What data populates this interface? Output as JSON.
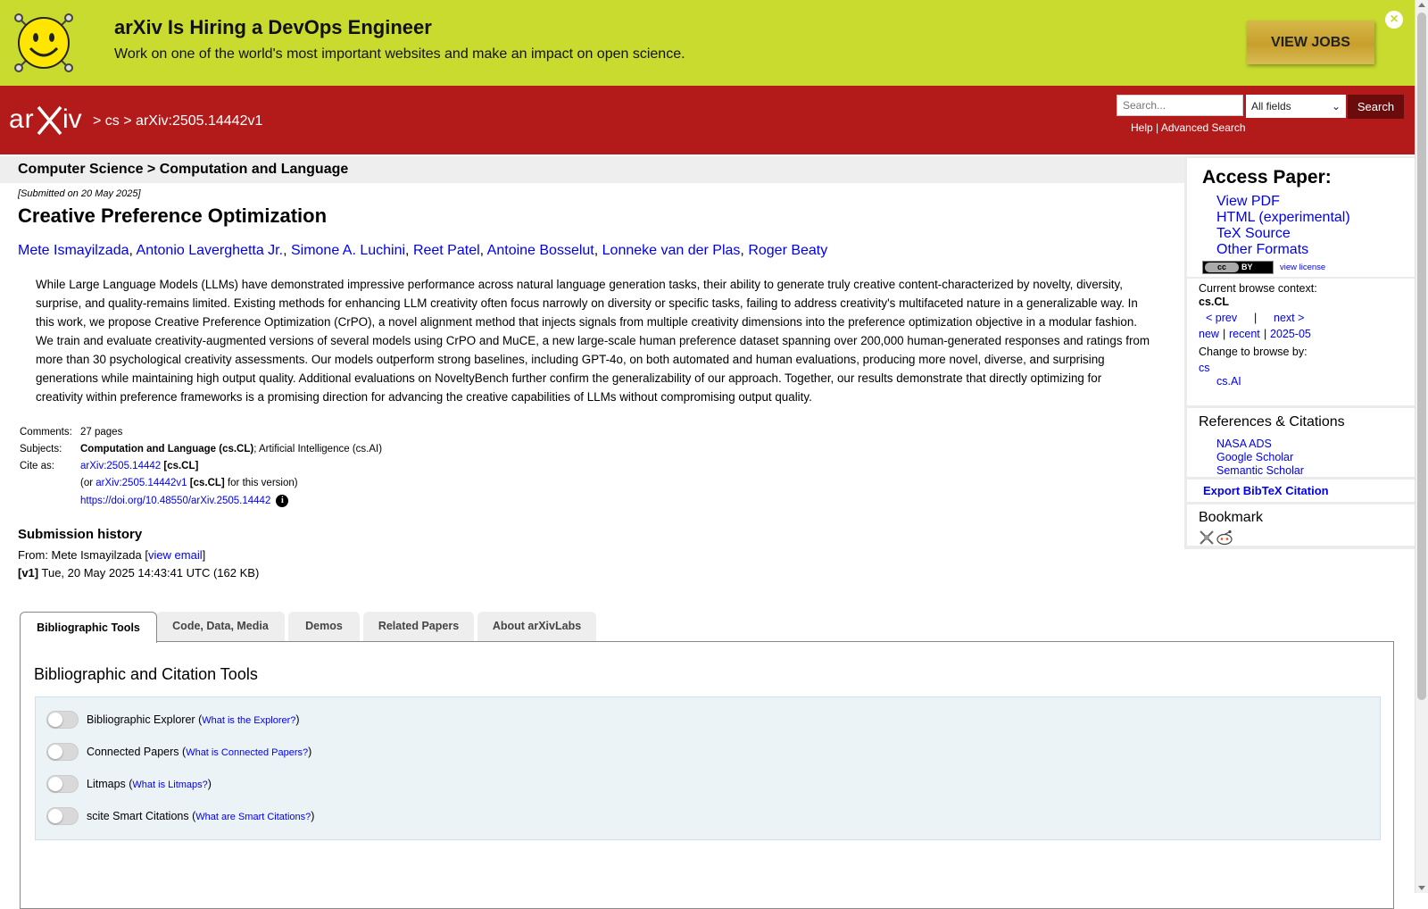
{
  "banner": {
    "title": "arXiv Is Hiring a DevOps Engineer",
    "subtitle": "Work on one of the world's most important websites and make an impact on open science.",
    "button": "VIEW JOBS",
    "close_icon": "close-circle-icon"
  },
  "header": {
    "logo_text": "arXiv",
    "breadcrumb": {
      "sep1": ">",
      "cs": "cs",
      "sep2": ">",
      "paper": "arXiv:2505.14442v1"
    },
    "search": {
      "placeholder": "Search...",
      "field": "All fields",
      "button": "Search",
      "help": "Help",
      "pipe": "|",
      "advanced": "Advanced Search"
    }
  },
  "paper": {
    "subject_bar": "Computer Science > Computation and Language",
    "submitted": "[Submitted on 20 May 2025]",
    "title": "Creative Preference Optimization",
    "authors": [
      "Mete Ismayilzada",
      "Antonio Laverghetta Jr.",
      "Simone A. Luchini",
      "Reet Patel",
      "Antoine Bosselut",
      "Lonneke van der Plas",
      "Roger Beaty"
    ],
    "abstract": "While Large Language Models (LLMs) have demonstrated impressive performance across natural language generation tasks, their ability to generate truly creative content-characterized by novelty, diversity, surprise, and quality-remains limited. Existing methods for enhancing LLM creativity often focus narrowly on diversity or specific tasks, failing to address creativity's multifaceted nature in a generalizable way. In this work, we propose Creative Preference Optimization (CrPO), a novel alignment method that injects signals from multiple creativity dimensions into the preference optimization objective in a modular fashion. We train and evaluate creativity-augmented versions of several models using CrPO and MuCE, a new large-scale human preference dataset spanning over 200,000 human-generated responses and ratings from more than 30 psychological creativity assessments. Our models outperform strong baselines, including GPT-4o, on both automated and human evaluations, producing more novel, diverse, and surprising generations while maintaining high output quality. Additional evaluations on NoveltyBench further confirm the generalizability of our approach. Together, our results demonstrate that directly optimizing for creativity within preference frameworks is a promising direction for advancing the creative capabilities of LLMs without compromising output quality.",
    "meta": {
      "comments_label": "Comments:",
      "comments": "27 pages",
      "subjects_label": "Subjects:",
      "subjects_primary": "Computation and Language (cs.CL)",
      "subjects_rest": "; Artificial Intelligence (cs.AI)",
      "cite_label": "Cite as:",
      "cite_id": "arXiv:2505.14442",
      "cite_tag": "[cs.CL]",
      "cite_or": "(or",
      "cite_version_id": "arXiv:2505.14442v1",
      "cite_version_tag": "[cs.CL]",
      "cite_version_suffix": "for this version)",
      "doi": "https://doi.org/10.48550/arXiv.2505.14442"
    },
    "history": {
      "title": "Submission history",
      "from_prefix": "From: Mete Ismayilzada [",
      "from_link": "view email",
      "from_suffix": "]",
      "v1_tag": "[v1]",
      "v1_text": "Tue, 20 May 2025 14:43:41 UTC (162 KB)"
    }
  },
  "tabs": [
    "Bibliographic Tools",
    "Code, Data, Media",
    "Demos",
    "Related Papers",
    "About arXivLabs"
  ],
  "tools": {
    "heading": "Bibliographic and Citation Tools",
    "items": [
      {
        "label": "Bibliographic Explorer",
        "link": "What is the Explorer?"
      },
      {
        "label": "Connected Papers",
        "link": "What is Connected Papers?"
      },
      {
        "label": "Litmaps",
        "link": "What is Litmaps?"
      },
      {
        "label": "scite Smart Citations",
        "link": "What are Smart Citations?"
      }
    ]
  },
  "sidebar": {
    "access_title": "Access Paper:",
    "access_links": [
      "View PDF",
      "HTML (experimental)",
      "TeX Source",
      "Other Formats"
    ],
    "license_cc": "cc",
    "license_by": "BY",
    "view_license": "view license",
    "browse": {
      "context_label": "Current browse context:",
      "context": "cs.CL",
      "prev": "< prev",
      "sep": "|",
      "next": "next >",
      "new": "new",
      "recent": "recent",
      "month": "2025-05",
      "change_label": "Change to browse by:",
      "cs": "cs",
      "csai": "cs.AI"
    },
    "refs_title": "References & Citations",
    "refs": [
      "NASA ADS",
      "Google Scholar",
      "Semantic Scholar"
    ],
    "export_bibtex": "Export BibTeX Citation",
    "bookmark_title": "Bookmark"
  },
  "colors": {
    "banner": "#c9db2f",
    "header": "#b31b1b",
    "link": "#0000ee",
    "search_button": "#6b0c0c"
  }
}
